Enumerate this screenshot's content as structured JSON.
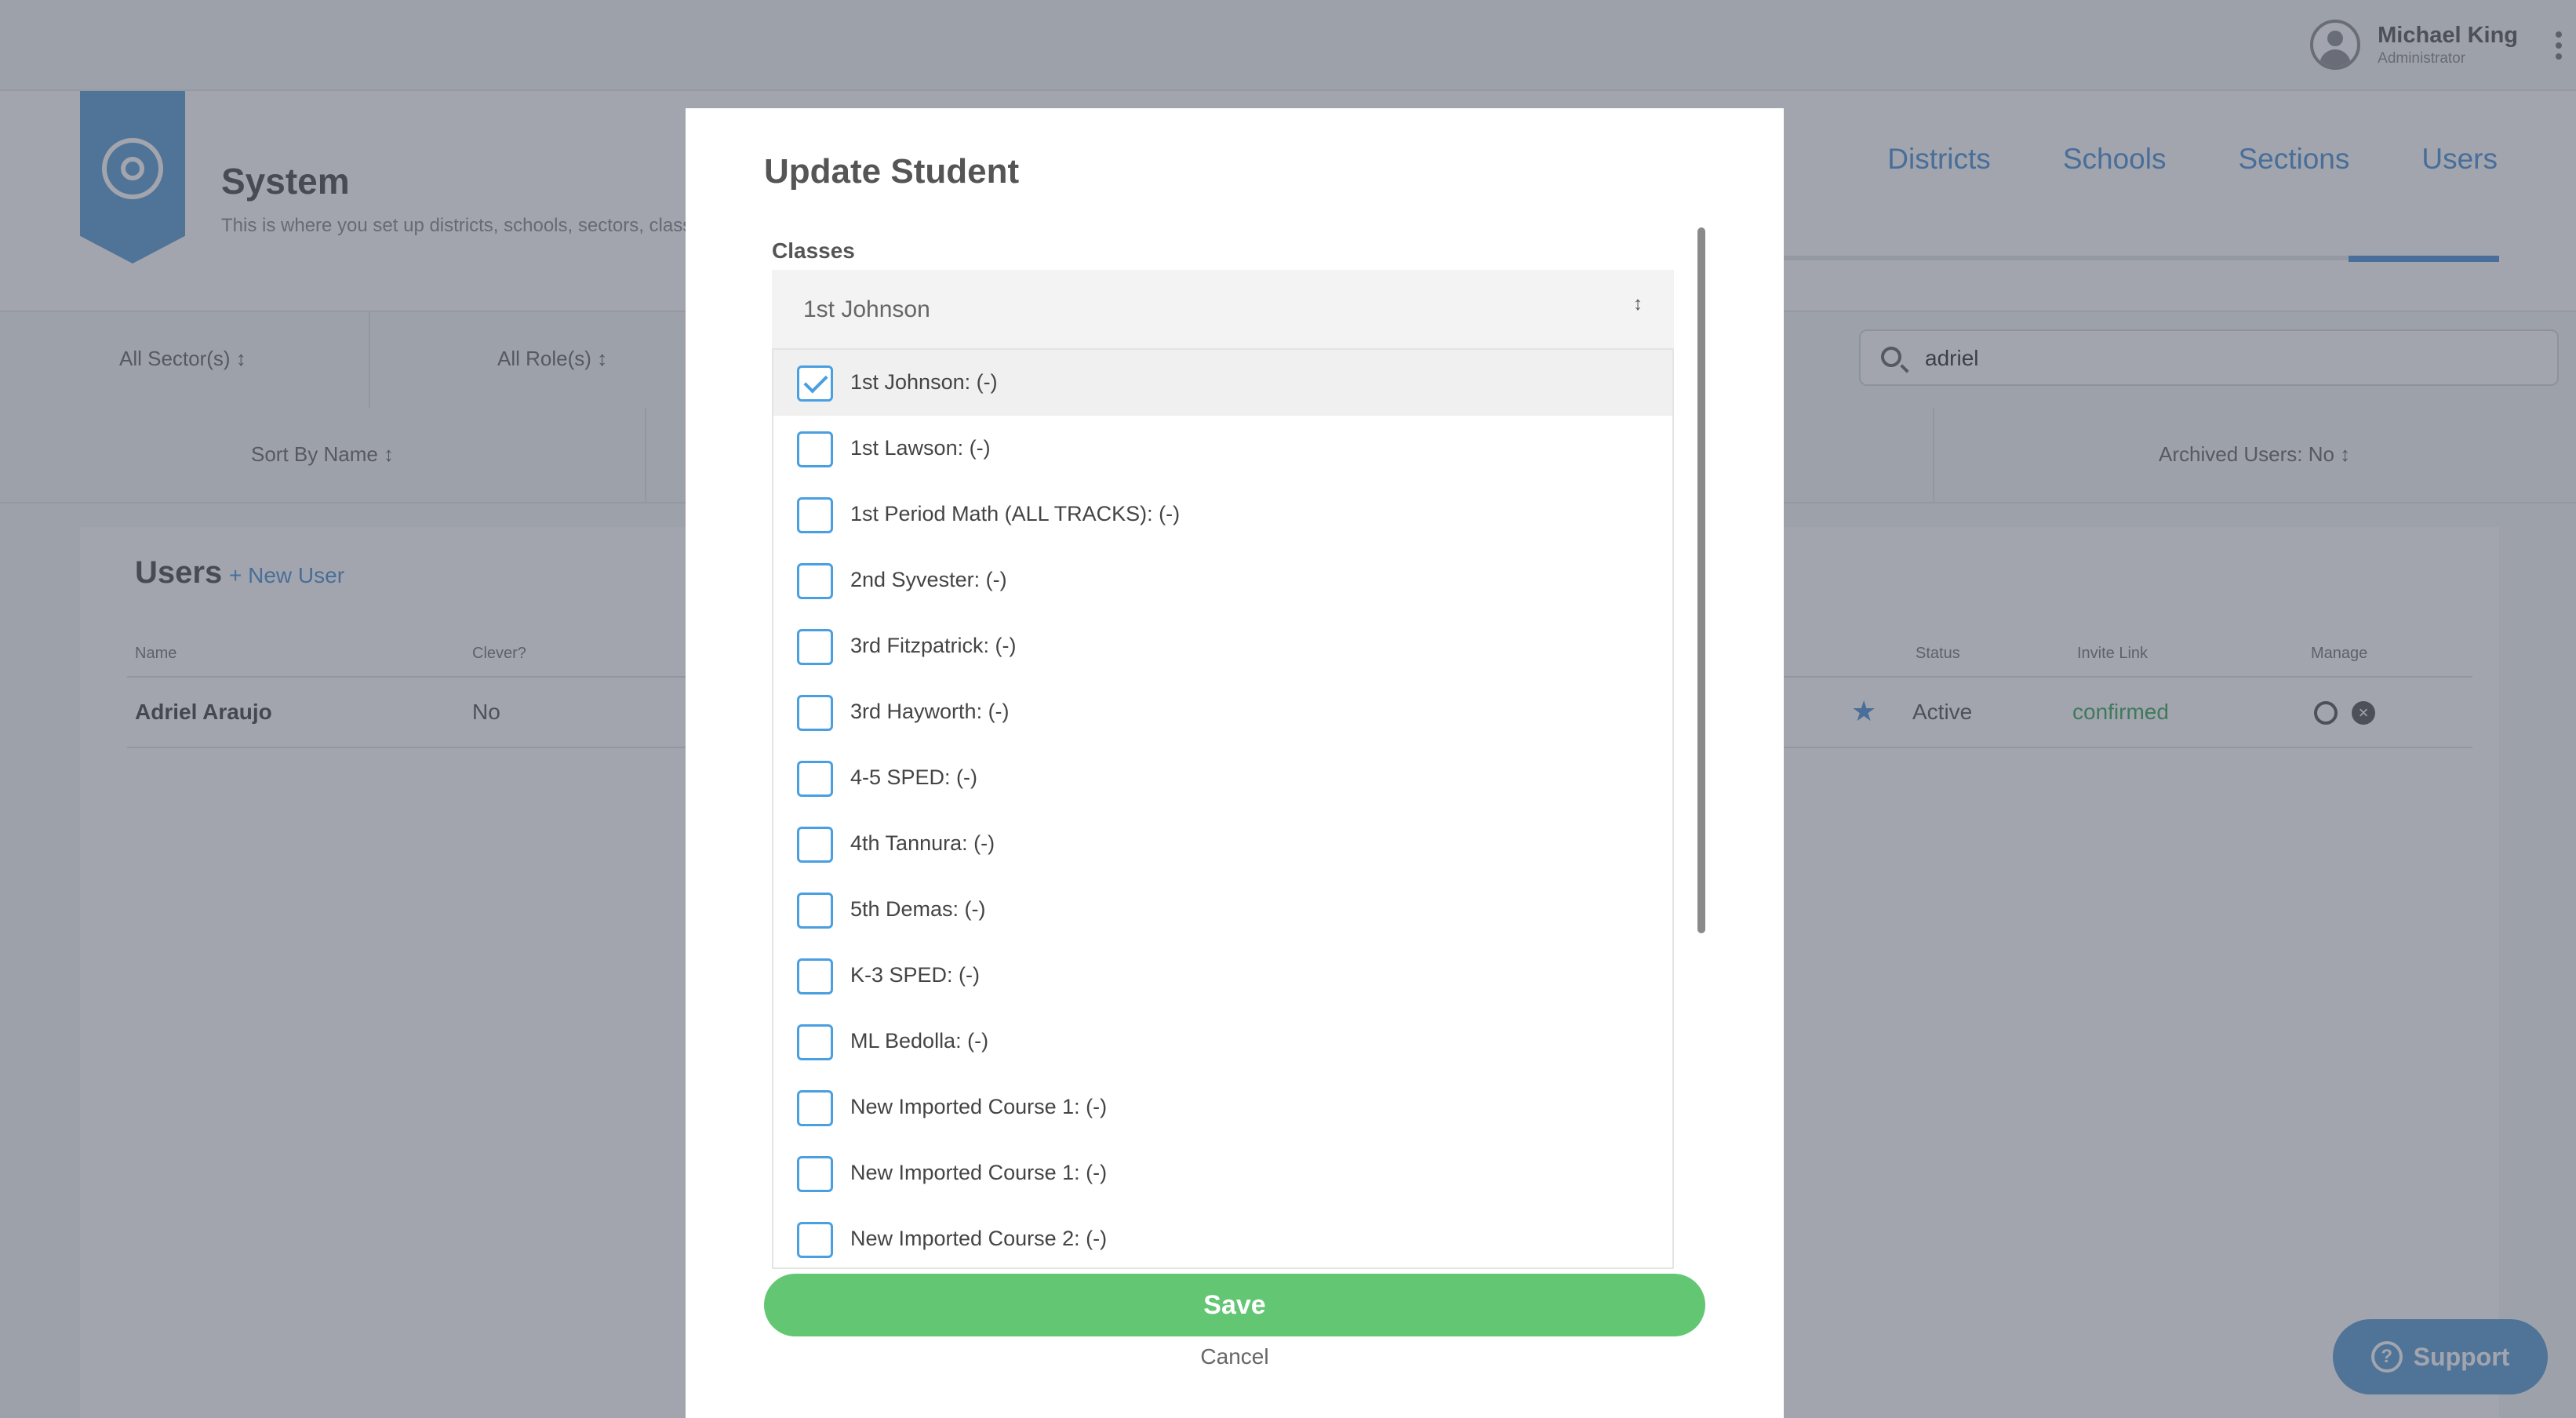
{
  "topbar": {
    "user_name": "Michael King",
    "user_role": "Administrator"
  },
  "header": {
    "title": "System",
    "description": "This is where you set up districts, schools, sectors, classes",
    "tabs": [
      "Districts",
      "Schools",
      "Sections",
      "Users"
    ],
    "active_tab": "Users"
  },
  "filters": {
    "sectors": "All Sector(s) ↕",
    "roles": "All Role(s) ↕",
    "search_value": "adriel"
  },
  "sort": {
    "by_name": "Sort By Name ↕",
    "archived": "Archived Users: No ↕"
  },
  "users": {
    "title": "Users",
    "new_user": "+ New User",
    "columns": {
      "name": "Name",
      "clever": "Clever?",
      "status": "Status",
      "invite_link": "Invite Link",
      "manage": "Manage"
    },
    "row": {
      "name": "Adriel Araujo",
      "clever": "No",
      "status": "Active",
      "invite": "confirmed"
    }
  },
  "support": {
    "label": "Support"
  },
  "modal": {
    "title": "Update Student",
    "classes_label": "Classes",
    "selected_value": "1st Johnson",
    "select_arrows": "↕",
    "options": [
      {
        "label": "1st Johnson: (-)",
        "checked": true
      },
      {
        "label": "1st Lawson: (-)",
        "checked": false
      },
      {
        "label": "1st Period Math (ALL TRACKS): (-)",
        "checked": false
      },
      {
        "label": "2nd Syvester: (-)",
        "checked": false
      },
      {
        "label": "3rd Fitzpatrick: (-)",
        "checked": false
      },
      {
        "label": "3rd Hayworth: (-)",
        "checked": false
      },
      {
        "label": "4-5 SPED: (-)",
        "checked": false
      },
      {
        "label": "4th Tannura: (-)",
        "checked": false
      },
      {
        "label": "5th Demas: (-)",
        "checked": false
      },
      {
        "label": "K-3 SPED: (-)",
        "checked": false
      },
      {
        "label": "ML Bedolla: (-)",
        "checked": false
      },
      {
        "label": "New Imported Course 1: (-)",
        "checked": false
      },
      {
        "label": "New Imported Course 1: (-)",
        "checked": false
      },
      {
        "label": "New Imported Course 2: (-)",
        "checked": false
      }
    ],
    "save_label": "Save",
    "cancel_label": "Cancel"
  }
}
